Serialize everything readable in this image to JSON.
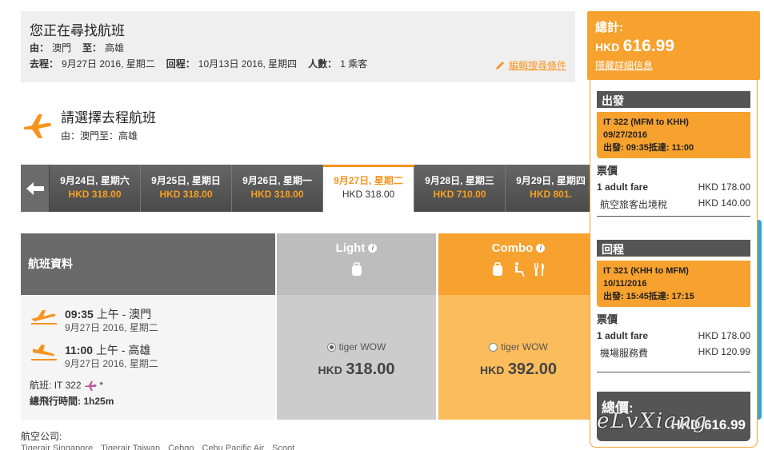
{
  "search": {
    "title": "您正在尋找航班",
    "from_label": "由：",
    "from": "澳門",
    "to_label": "至：",
    "to": "高雄",
    "depart_label": "去程：",
    "depart": "9月27日 2016, 星期二",
    "return_label": "回程：",
    "return": "10月13日 2016, 星期四",
    "pax_label": "人數：",
    "pax": "1 乘客",
    "edit_link": "編輯搜尋條件"
  },
  "select": {
    "title": "請選擇去程航班",
    "route_from_label": "由：",
    "route_from": "澳門",
    "route_to_label": "至：",
    "route_to": "高雄"
  },
  "dates": [
    {
      "date": "9月24日, 星期六",
      "price": "HKD 318.00",
      "active": false
    },
    {
      "date": "9月25日, 星期日",
      "price": "HKD 318.00",
      "active": false
    },
    {
      "date": "9月26日, 星期一",
      "price": "HKD 318.00",
      "active": false
    },
    {
      "date": "9月27日, 星期二",
      "price": "HKD 318.00",
      "active": true
    },
    {
      "date": "9月28日, 星期三",
      "price": "HKD 710.00",
      "active": false
    },
    {
      "date": "9月29日, 星期四",
      "price": "HKD 801.",
      "active": false
    }
  ],
  "flights": {
    "header": "航班資料",
    "depart_time": "09:35",
    "depart_ampm": "上午",
    "depart_city": "澳門",
    "depart_date": "9月27日 2016, 星期二",
    "arrive_time": "11:00",
    "arrive_ampm": "上午",
    "arrive_city": "高雄",
    "arrive_date": "9月27日 2016, 星期二",
    "flight_label": "航班:",
    "flight_no": "IT 322",
    "flight_star": "*",
    "duration_label": "總飛行時間:",
    "duration": "1h25m"
  },
  "fares": {
    "light": {
      "name": "Light",
      "option": "tiger WOW",
      "currency": "HKD",
      "amount": "318.00",
      "selected": true
    },
    "combo": {
      "name": "Combo",
      "option": "tiger WOW",
      "currency": "HKD",
      "amount": "392.00",
      "selected": false
    }
  },
  "airlines": {
    "label": "航空公司:",
    "list": [
      "Tigerair Singapore",
      "Tigerair Taiwan",
      "Cebgo",
      "Cebu Pacific Air",
      "Scoot"
    ]
  },
  "summary": {
    "total_label": "總計:",
    "total_currency": "HKD",
    "total_amount": "616.99",
    "hide_link": "隱藏詳細信息",
    "depart_head": "出發",
    "depart_flight": "IT 322 (MFM to KHH)",
    "depart_date": "09/27/2016",
    "depart_times": "出發: 09:35抵達: 11:00",
    "fare_title_1": "票價",
    "adult_fare_1_label": "1 adult fare",
    "adult_fare_1": "HKD 178.00",
    "tax_1_label": "航空旅客出境稅",
    "tax_1": "HKD 140.00",
    "return_head": "回程",
    "return_flight": "IT 321 (KHH to MFM)",
    "return_date": "10/11/2016",
    "return_times": "出發: 15:45抵達: 17:15",
    "fare_title_2": "票價",
    "adult_fare_2_label": "1 adult fare",
    "adult_fare_2": "HKD 178.00",
    "tax_2_label": "機場服務費",
    "tax_2": "HKD 120.99",
    "grand_label": "總價:",
    "grand_amount": "HKD 616.99"
  },
  "watermark": "eLvXiang",
  "colors": {
    "accent": "#f7a12e",
    "dark": "#555555",
    "light_fare": "#bdbdbd",
    "combo_fare": "#f7a12e"
  }
}
